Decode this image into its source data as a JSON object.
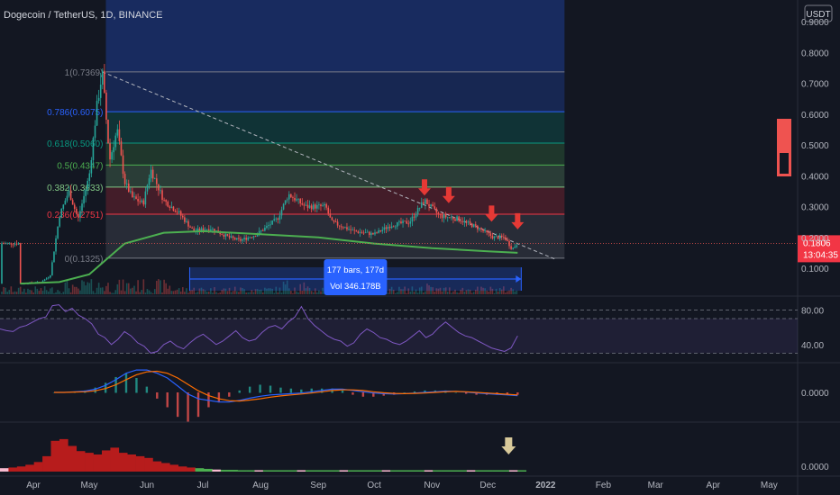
{
  "header": {
    "symbol_title": "Dogecoin / TetherUS, 1D, BINANCE",
    "currency_badge": "USDT"
  },
  "price_axis": {
    "ticks": [
      "0.9000",
      "0.8000",
      "0.7000",
      "0.6000",
      "0.5000",
      "0.4000",
      "0.3000",
      "0.2000",
      "0.1000"
    ],
    "last_price": "0.1806",
    "countdown": "13:04:35"
  },
  "rsi_axis": {
    "ticks": [
      "80.00",
      "40.00"
    ]
  },
  "macd_axis": {
    "ticks": [
      "0.0000"
    ]
  },
  "osc_axis": {
    "ticks": [
      "0.0000"
    ]
  },
  "time_axis": {
    "labels": [
      "Apr",
      "May",
      "Jun",
      "Jul",
      "Aug",
      "Sep",
      "Oct",
      "Nov",
      "Dec",
      "2022",
      "Feb",
      "Mar",
      "Apr",
      "May"
    ]
  },
  "measure_tool": {
    "bars_text": "177 bars, 177d",
    "volume_text": "Vol 346.178B"
  },
  "colors": {
    "background": "#131722",
    "up": "#26a69a",
    "down": "#ef5350",
    "ma_line": "#4caf50",
    "rsi_line": "#7e57c2",
    "macd_line": "#2962ff",
    "signal_line": "#ff6d00",
    "last_price_tag": "#f23645",
    "measure_blue": "#2962ff",
    "annotation_red": "#e53935",
    "annotation_arrow_tan": "#d8c99a"
  },
  "chart_data": {
    "type": "candlestick",
    "title": "Dogecoin / TetherUS, 1D, BINANCE",
    "y_scale": "linear",
    "ylim": [
      0.02,
      0.95
    ],
    "x_range": [
      "2021-03-25",
      "2022-05-10"
    ],
    "last_price": 0.1806,
    "price_path": [
      [
        "2021-03-25",
        0.05
      ],
      [
        "2021-04-05",
        0.055
      ],
      [
        "2021-04-10",
        0.075
      ],
      [
        "2021-04-15",
        0.27
      ],
      [
        "2021-04-20",
        0.35
      ],
      [
        "2021-04-25",
        0.26
      ],
      [
        "2021-05-01",
        0.4
      ],
      [
        "2021-05-05",
        0.62
      ],
      [
        "2021-05-08",
        0.7369
      ],
      [
        "2021-05-12",
        0.45
      ],
      [
        "2021-05-16",
        0.55
      ],
      [
        "2021-05-20",
        0.38
      ],
      [
        "2021-05-24",
        0.33
      ],
      [
        "2021-05-30",
        0.31
      ],
      [
        "2021-06-03",
        0.42
      ],
      [
        "2021-06-10",
        0.32
      ],
      [
        "2021-06-18",
        0.28
      ],
      [
        "2021-06-26",
        0.22
      ],
      [
        "2021-07-05",
        0.23
      ],
      [
        "2021-07-15",
        0.2
      ],
      [
        "2021-07-21",
        0.19
      ],
      [
        "2021-07-30",
        0.21
      ],
      [
        "2021-08-10",
        0.26
      ],
      [
        "2021-08-16",
        0.34
      ],
      [
        "2021-08-25",
        0.3
      ],
      [
        "2021-09-05",
        0.3
      ],
      [
        "2021-09-08",
        0.25
      ],
      [
        "2021-09-20",
        0.22
      ],
      [
        "2021-10-01",
        0.21
      ],
      [
        "2021-10-10",
        0.24
      ],
      [
        "2021-10-20",
        0.25
      ],
      [
        "2021-10-28",
        0.32
      ],
      [
        "2021-11-05",
        0.27
      ],
      [
        "2021-11-15",
        0.26
      ],
      [
        "2021-11-26",
        0.23
      ],
      [
        "2021-12-04",
        0.2
      ],
      [
        "2021-12-10",
        0.2
      ],
      [
        "2021-12-14",
        0.162
      ],
      [
        "2021-12-17",
        0.1806
      ]
    ],
    "moving_average": [
      [
        "2021-03-25",
        0.05
      ],
      [
        "2021-04-15",
        0.055
      ],
      [
        "2021-05-01",
        0.08
      ],
      [
        "2021-05-20",
        0.18
      ],
      [
        "2021-06-10",
        0.215
      ],
      [
        "2021-07-01",
        0.22
      ],
      [
        "2021-08-01",
        0.21
      ],
      [
        "2021-09-01",
        0.2
      ],
      [
        "2021-10-01",
        0.18
      ],
      [
        "2021-11-01",
        0.165
      ],
      [
        "2021-12-01",
        0.155
      ],
      [
        "2021-12-17",
        0.15
      ]
    ],
    "fibonacci": {
      "start_date": "2021-05-08",
      "end_date": "2021-12-17",
      "levels": [
        {
          "ratio": 1,
          "label": "1(0.7369)",
          "price": 0.7369,
          "color": "#787b86"
        },
        {
          "ratio": 0.786,
          "label": "0.786(0.6075)",
          "price": 0.6075,
          "color": "#2962ff"
        },
        {
          "ratio": 0.618,
          "label": "0.618(0.5060)",
          "price": 0.506,
          "color": "#089981"
        },
        {
          "ratio": 0.5,
          "label": "0.5(0.4347)",
          "price": 0.4347,
          "color": "#4caf50"
        },
        {
          "ratio": 0.382,
          "label": "0.382(0.3633)",
          "price": 0.3633,
          "color": "#81c784"
        },
        {
          "ratio": 0.236,
          "label": "0.236(0.2751)",
          "price": 0.2751,
          "color": "#f23645"
        },
        {
          "ratio": 0,
          "label": "0(0.1325)",
          "price": 0.1325,
          "color": "#787b86"
        }
      ]
    },
    "trend_line": [
      [
        "2021-05-08",
        0.7369
      ],
      [
        "2022-01-01",
        0.13
      ]
    ],
    "annotations": [
      {
        "type": "down-arrow",
        "date": "2021-10-28",
        "price": 0.33
      },
      {
        "type": "down-arrow",
        "date": "2021-11-10",
        "price": 0.305
      },
      {
        "type": "down-arrow",
        "date": "2021-12-03",
        "price": 0.245
      },
      {
        "type": "down-arrow",
        "date": "2021-12-17",
        "price": 0.22
      }
    ],
    "measure": {
      "from": "2021-06-22",
      "to": "2021-12-17",
      "bars": 177,
      "days": 177,
      "volume": "346.178B"
    },
    "rsi": {
      "ylim": [
        20,
        95
      ],
      "levels": [
        80,
        70,
        30
      ],
      "values": [
        58,
        56,
        55,
        60,
        62,
        66,
        70,
        72,
        85,
        86,
        78,
        82,
        74,
        70,
        64,
        52,
        48,
        40,
        46,
        55,
        50,
        42,
        38,
        30,
        32,
        40,
        44,
        38,
        35,
        42,
        48,
        52,
        46,
        40,
        44,
        50,
        56,
        48,
        44,
        46,
        54,
        60,
        62,
        58,
        66,
        72,
        84,
        70,
        62,
        56,
        50,
        46,
        44,
        38,
        42,
        52,
        58,
        54,
        48,
        46,
        42,
        40,
        44,
        50,
        56,
        48,
        52,
        60,
        66,
        60,
        54,
        50,
        48,
        44,
        40,
        36,
        34,
        32,
        36,
        50
      ]
    },
    "macd": {
      "ylim": [
        -0.09,
        0.09
      ],
      "macd": [
        0,
        0,
        0.002,
        0.004,
        0.01,
        0.022,
        0.04,
        0.06,
        0.07,
        0.07,
        0.06,
        0.045,
        0.02,
        -0.005,
        -0.02,
        -0.025,
        -0.03,
        -0.03,
        -0.025,
        -0.018,
        -0.012,
        -0.008,
        -0.006,
        -0.004,
        -0.002,
        0.002,
        0.006,
        0.01,
        0.01,
        0.006,
        0.002,
        -0.002,
        -0.004,
        -0.005,
        -0.004,
        -0.002,
        0,
        0.002,
        0.004,
        0.003,
        0.001,
        -0.002,
        -0.004,
        -0.006,
        -0.008,
        -0.01
      ],
      "signal": [
        0,
        0,
        0.001,
        0.002,
        0.005,
        0.012,
        0.024,
        0.04,
        0.055,
        0.064,
        0.066,
        0.06,
        0.045,
        0.025,
        0.005,
        -0.01,
        -0.02,
        -0.026,
        -0.027,
        -0.024,
        -0.02,
        -0.015,
        -0.011,
        -0.008,
        -0.005,
        -0.002,
        0.002,
        0.006,
        0.008,
        0.008,
        0.006,
        0.002,
        -0.001,
        -0.003,
        -0.004,
        -0.003,
        -0.002,
        0,
        0.002,
        0.003,
        0.002,
        0,
        -0.002,
        -0.004,
        -0.006,
        -0.008
      ]
    },
    "oscillator": {
      "ylim": [
        0,
        1
      ],
      "values": [
        0.1,
        0.12,
        0.15,
        0.2,
        0.28,
        0.45,
        0.9,
        0.95,
        0.75,
        0.6,
        0.55,
        0.5,
        0.62,
        0.7,
        0.55,
        0.5,
        0.45,
        0.4,
        0.3,
        0.25,
        0.2,
        0.15,
        0.12,
        0.1,
        0.08,
        0.06,
        0.05,
        0.05,
        0.04,
        0.04,
        0.04,
        0.04,
        0.04,
        0.04,
        0.04,
        0.04,
        0.04,
        0.04,
        0.04,
        0.04,
        0.04,
        0.04,
        0.04,
        0.04,
        0.04,
        0.04,
        0.04,
        0.04,
        0.04,
        0.04,
        0.04,
        0.04,
        0.04,
        0.04,
        0.04,
        0.04,
        0.04,
        0.04,
        0.04,
        0.04,
        0.04,
        0.04
      ]
    }
  }
}
